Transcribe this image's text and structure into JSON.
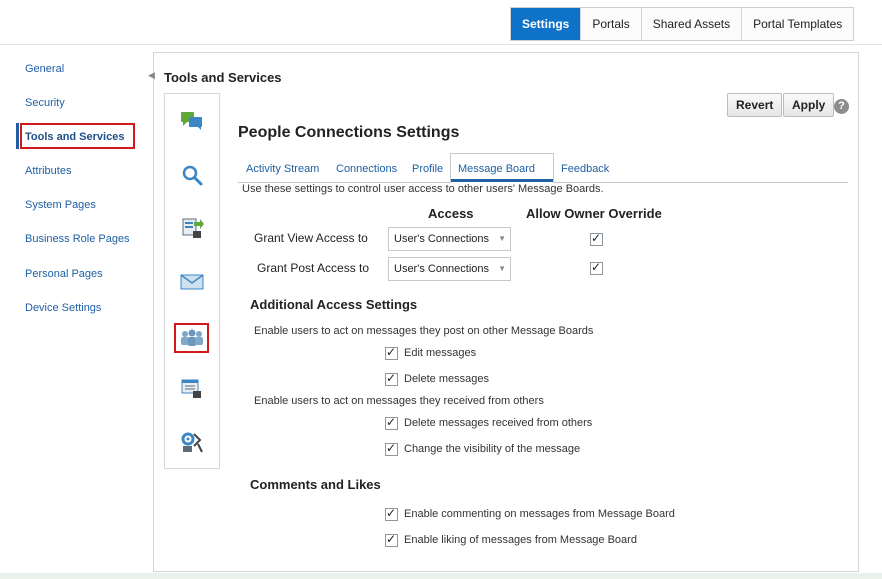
{
  "top_tabs": [
    {
      "label": "Settings",
      "active": true
    },
    {
      "label": "Portals",
      "active": false
    },
    {
      "label": "Shared Assets",
      "active": false
    },
    {
      "label": "Portal Templates",
      "active": false
    }
  ],
  "sidebar": {
    "items": [
      {
        "label": "General"
      },
      {
        "label": "Security"
      },
      {
        "label": "Tools and Services",
        "active": true
      },
      {
        "label": "Attributes"
      },
      {
        "label": "System Pages"
      },
      {
        "label": "Business Role Pages"
      },
      {
        "label": "Personal Pages"
      },
      {
        "label": "Device Settings"
      }
    ]
  },
  "panel": {
    "title": "Tools and Services",
    "tool_icons": [
      "discussion-icon",
      "search-icon",
      "document-exchange-icon",
      "mail-icon",
      "people-connections-icon",
      "events-icon",
      "tools-icon"
    ],
    "revert_label": "Revert",
    "apply_label": "Apply",
    "help_label": "?"
  },
  "people": {
    "title": "People Connections Settings",
    "tabs": [
      {
        "label": "Activity Stream"
      },
      {
        "label": "Connections"
      },
      {
        "label": "Profile"
      },
      {
        "label": "Message Board",
        "active": true
      },
      {
        "label": "Feedback"
      }
    ],
    "description": "Use these settings to control user access to other users' Message Boards.",
    "col_access": "Access",
    "col_override": "Allow Owner Override",
    "rows": [
      {
        "label": "Grant View Access to",
        "value": "User's Connections",
        "override": true
      },
      {
        "label": "Grant Post Access to",
        "value": "User's Connections",
        "override": true
      }
    ],
    "additional_title": "Additional Access Settings",
    "post_note": "Enable users to act on messages they post on other Message Boards",
    "edit_label": "Edit messages",
    "delete_label": "Delete messages",
    "received_note": "Enable users to act on messages they received from others",
    "delete_received_label": "Delete messages received from others",
    "visibility_label": "Change the visibility of the message",
    "comments_title": "Comments and Likes",
    "commenting_label": "Enable commenting on messages from Message Board",
    "liking_label": "Enable liking of messages from Message Board"
  }
}
